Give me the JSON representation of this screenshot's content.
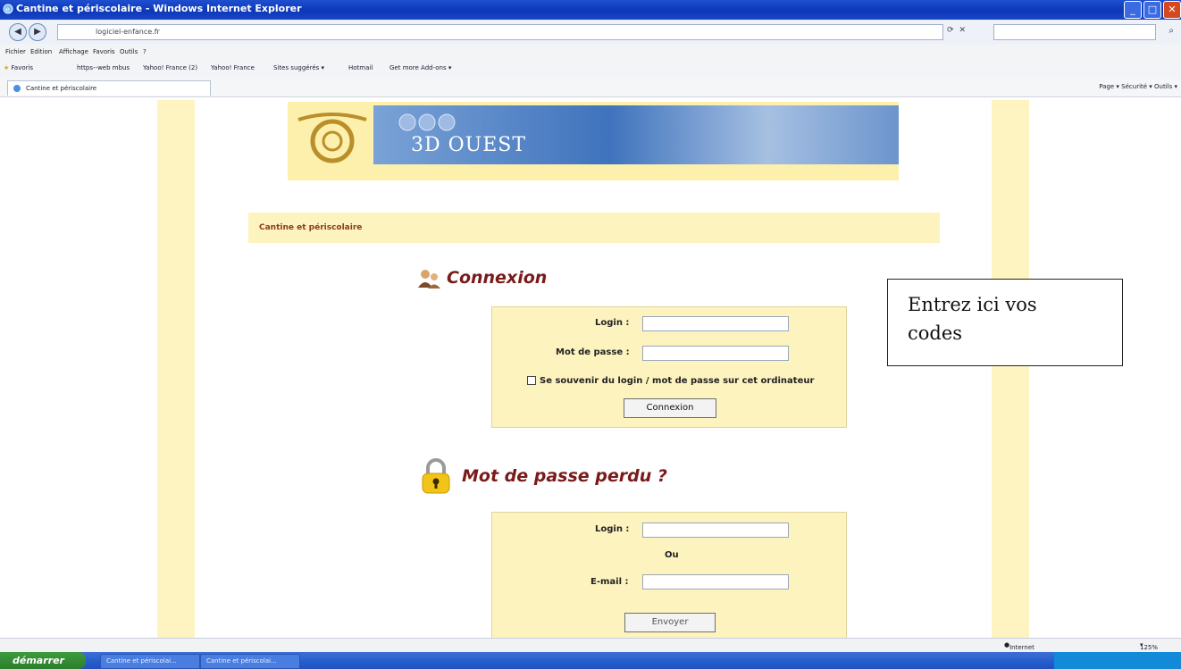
{
  "window": {
    "title": "Cantine et périscolaire - Windows Internet Explorer",
    "address": "logiciel-enfance.fr"
  },
  "menu": [
    "Fichier",
    "Edition",
    "Affichage",
    "Favoris",
    "Outils",
    "?"
  ],
  "favorites": {
    "label": "Favoris",
    "items": [
      "https--web mbus",
      "Yahoo! France (2)",
      "Yahoo! France",
      "Sites suggérés ▾",
      "Hotmail",
      "Get more Add-ons ▾"
    ]
  },
  "tab": {
    "label": "Cantine et périscolaire"
  },
  "commands": "Page ▾   Sécurité ▾   Outils ▾",
  "page": {
    "banner_text": "3D OUEST",
    "site_title": "Cantine et périscolaire",
    "connexion": {
      "title": "Connexion",
      "login_label": "Login :",
      "password_label": "Mot de passe :",
      "remember_label": "Se souvenir du login / mot de passe sur cet ordinateur",
      "submit_label": "Connexion"
    },
    "lost_password": {
      "title": "Mot de passe perdu ?",
      "login_label": "Login :",
      "or_label": "Ou",
      "email_label": "E-mail :",
      "submit_label": "Envoyer"
    },
    "callout_line1": "Entrez ici vos",
    "callout_line2": "codes"
  },
  "statusbar": {
    "zone": "Internet",
    "zoom": "125%"
  },
  "taskbar": {
    "start_label": "démarrer",
    "tasks": [
      "Cantine et périscolai...",
      "Cantine et périscolai..."
    ]
  }
}
